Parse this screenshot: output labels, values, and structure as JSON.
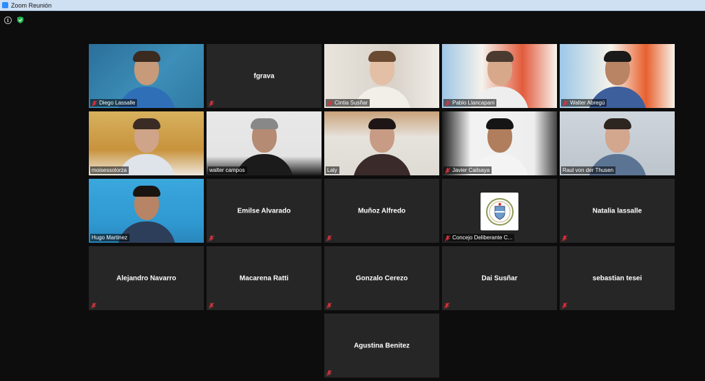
{
  "window": {
    "title": "Zoom Reunión"
  },
  "status": {
    "info_icon": "info-icon",
    "security_icon": "shield-check-icon"
  },
  "participants": [
    {
      "name": "Diego Lassalle",
      "video": true,
      "muted": true,
      "show_label": true
    },
    {
      "name": "fgrava",
      "video": false,
      "muted": true
    },
    {
      "name": "Cintia Susñar",
      "video": true,
      "muted": true,
      "show_label": true
    },
    {
      "name": "Pablo Llancapani",
      "video": true,
      "muted": true,
      "show_label": true
    },
    {
      "name": "Walter Abregú",
      "video": true,
      "muted": true,
      "show_label": true
    },
    {
      "name": "moisessolorza",
      "video": true,
      "muted": false,
      "show_label": true
    },
    {
      "name": "walter campos",
      "video": true,
      "muted": false,
      "show_label": true
    },
    {
      "name": "Laly",
      "video": true,
      "muted": false,
      "show_label": true
    },
    {
      "name": "Javier Cailsaya",
      "video": true,
      "muted": true,
      "show_label": true
    },
    {
      "name": "Raul von der Thusen",
      "video": true,
      "muted": false,
      "show_label": true,
      "active_speaker": true
    },
    {
      "name": "Hugo Martinez",
      "video": true,
      "muted": false,
      "show_label": true
    },
    {
      "name": "Emilse Alvarado",
      "video": false,
      "muted": true
    },
    {
      "name": "Muñoz Alfredo",
      "video": false,
      "muted": true
    },
    {
      "name": "Concejo Deliberante C...",
      "video": false,
      "muted": true,
      "show_label": true,
      "avatar": "crest-logo"
    },
    {
      "name": "Natalia lassalle",
      "video": false,
      "muted": true
    },
    {
      "name": "Alejandro Navarro",
      "video": false,
      "muted": true
    },
    {
      "name": "Macarena Ratti",
      "video": false,
      "muted": true
    },
    {
      "name": "Gonzalo Cerezo",
      "video": false,
      "muted": true
    },
    {
      "name": "Dai Susñar",
      "video": false,
      "muted": true
    },
    {
      "name": "sebastian tesei",
      "video": false,
      "muted": true
    },
    {
      "name": "Agustina Benitez",
      "video": false,
      "muted": true
    }
  ],
  "colors": {
    "tile_bg": "#262626",
    "mute_red": "#e0303a",
    "active_outline": "#d8e08a"
  }
}
